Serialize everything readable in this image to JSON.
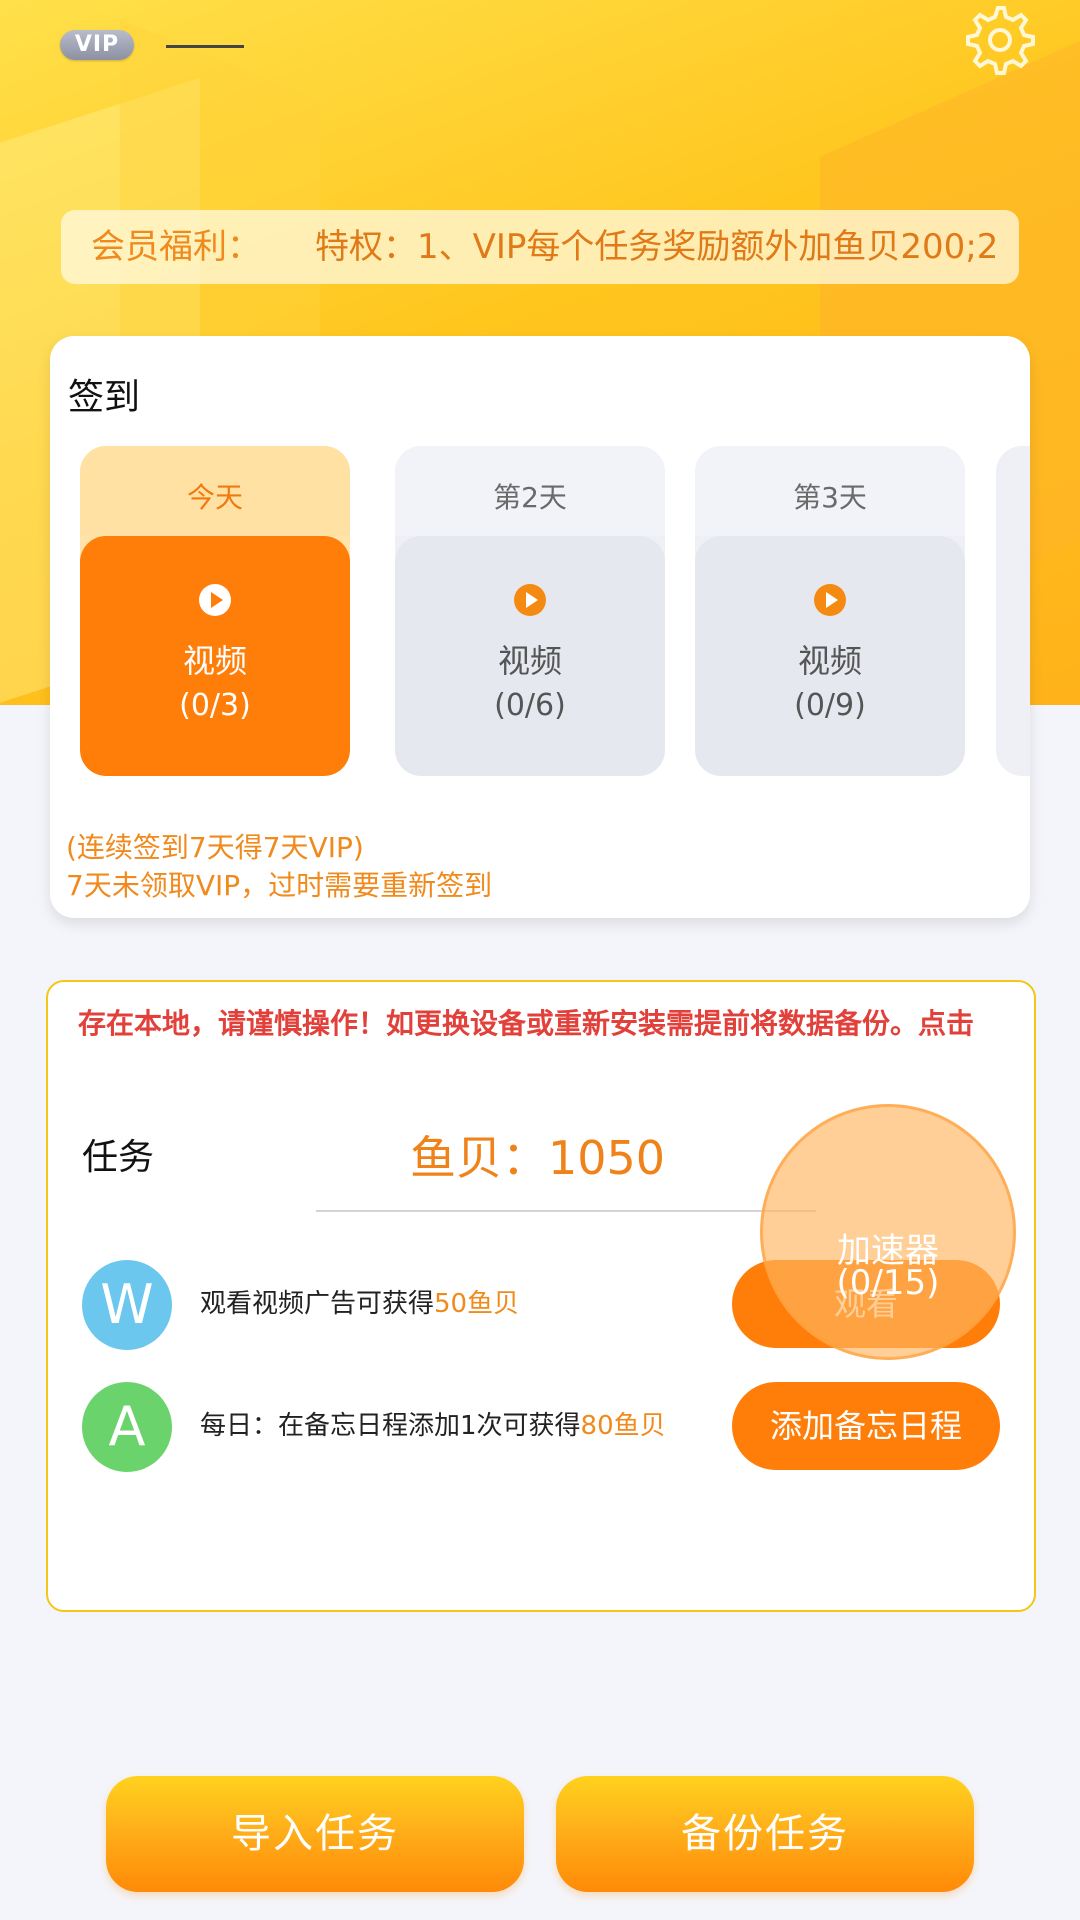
{
  "header": {
    "vip_badge": "VIP",
    "member_label": "会员福利：",
    "member_text": "特权：1、VIP每个任务奖励额外加鱼贝200;2"
  },
  "checkin": {
    "title": "签到",
    "days": [
      {
        "label": "今天",
        "type": "视频",
        "count": "(0/3)"
      },
      {
        "label": "第2天",
        "type": "视频",
        "count": "(0/6)"
      },
      {
        "label": "第3天",
        "type": "视频",
        "count": "(0/9)"
      }
    ],
    "note1": "(连续签到7天得7天VIP)",
    "note2": "7天未领取VIP，过时需要重新签到"
  },
  "tasks": {
    "notice": "存在本地，请谨慎操作！如更换设备或重新安装需提前将数据备份。点击",
    "title": "任务",
    "coins_label": "鱼贝：",
    "coins_value": "1050",
    "items": [
      {
        "avatar": "W",
        "avatar_color": "#6CC7EE",
        "desc_prefix": "观看视频广告可获得",
        "desc_highlight": "50鱼贝",
        "button": "观看"
      },
      {
        "avatar": "A",
        "avatar_color": "#6BD36B",
        "desc_prefix": "每日：在备忘日程添加1次可获得",
        "desc_highlight": "80鱼贝",
        "button": "添加备忘日程"
      }
    ],
    "accelerator_label": "加速器",
    "accelerator_count": "(0/15)"
  },
  "bottom": {
    "import_label": "导入任务",
    "backup_label": "备份任务"
  },
  "colors": {
    "accent": "#FF7E0A",
    "highlight_text": "#F08A1C",
    "notice_text": "#E2403A"
  },
  "icons": {
    "settings": "gear-icon",
    "play": "play-icon"
  }
}
